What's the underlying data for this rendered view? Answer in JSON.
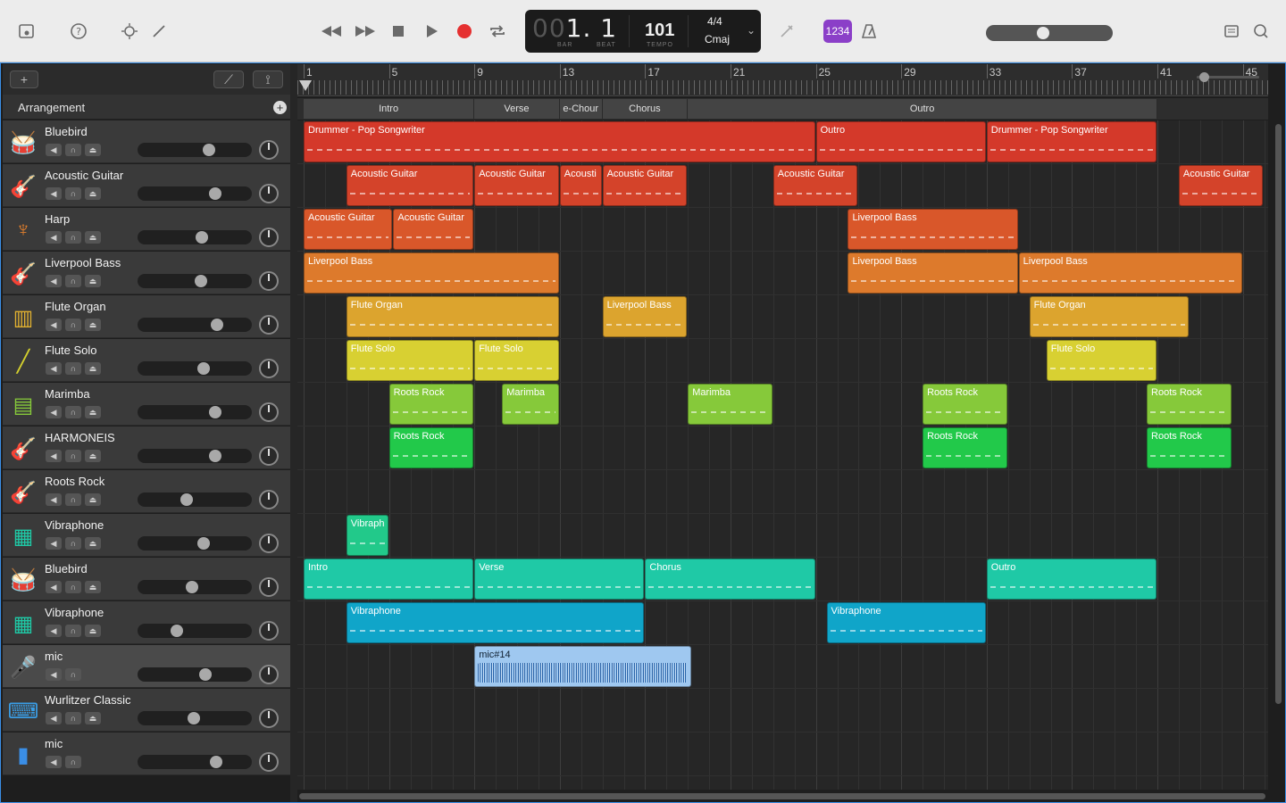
{
  "toolbar": {
    "lcd": {
      "bar_dim": "00",
      "bar": "1",
      "beat": "1",
      "bar_caption": "BAR",
      "beat_caption": "BEAT",
      "tempo": "101",
      "tempo_caption": "TEMPO",
      "signature": "4/4",
      "key": "Cmaj"
    },
    "count_in_label": "1234",
    "master_volume": 0.45,
    "accent_color": "#8b3fc8"
  },
  "sidebar": {
    "add_label": "+",
    "arrangement_label": "Arrangement"
  },
  "ruler": {
    "bars": [
      "1",
      "5",
      "9",
      "13",
      "17",
      "21",
      "25",
      "29",
      "33",
      "37",
      "41",
      "45"
    ]
  },
  "markers": [
    {
      "label": "Intro"
    },
    {
      "label": "Verse"
    },
    {
      "label": "e-Chour"
    },
    {
      "label": "Chorus"
    },
    {
      "label": "Outro"
    }
  ],
  "tracks": [
    {
      "name": "Bluebird",
      "icon": "drum-kit-icon",
      "volume": 0.65
    },
    {
      "name": "Acoustic Guitar",
      "icon": "acoustic-guitar-icon",
      "volume": 0.71
    },
    {
      "name": "Harp",
      "icon": "harp-icon",
      "volume": 0.58
    },
    {
      "name": "Liverpool Bass",
      "icon": "bass-guitar-icon",
      "volume": 0.57
    },
    {
      "name": "Flute Organ",
      "icon": "organ-icon",
      "volume": 0.73
    },
    {
      "name": "Flute Solo",
      "icon": "flute-icon",
      "volume": 0.6
    },
    {
      "name": "Marimba",
      "icon": "marimba-icon",
      "volume": 0.71
    },
    {
      "name": "HARMONEIS",
      "icon": "guitar-icon",
      "volume": 0.71
    },
    {
      "name": "Roots Rock",
      "icon": "guitar-icon",
      "volume": 0.43
    },
    {
      "name": "Vibraphone",
      "icon": "vibraphone-icon",
      "volume": 0.6
    },
    {
      "name": "Bluebird",
      "icon": "drum-kit-icon",
      "volume": 0.48
    },
    {
      "name": "Vibraphone",
      "icon": "vibraphone-icon",
      "volume": 0.33
    },
    {
      "name": "mic",
      "icon": "microphone-icon",
      "volume": 0.62
    },
    {
      "name": "Wurlitzer Classic",
      "icon": "keyboard-icon",
      "volume": 0.5
    },
    {
      "name": "mic",
      "icon": "audio-waveform-icon",
      "volume": 0.72
    }
  ],
  "regions": [
    {
      "track": 0,
      "start": 1,
      "end": 25,
      "label": "Drummer - Pop Songwriter",
      "color": "#d4392a"
    },
    {
      "track": 0,
      "start": 25,
      "end": 33,
      "label": "Outro",
      "color": "#d4392a"
    },
    {
      "track": 0,
      "start": 33,
      "end": 41,
      "label": "Drummer - Pop Songwriter",
      "color": "#d4392a"
    },
    {
      "track": 1,
      "start": 3,
      "end": 9,
      "label": "Acoustic Guitar",
      "color": "#d4432a"
    },
    {
      "track": 1,
      "start": 9,
      "end": 13,
      "label": "Acoustic Guitar",
      "color": "#d4432a"
    },
    {
      "track": 1,
      "start": 13,
      "end": 15,
      "label": "Acousti",
      "color": "#d4432a"
    },
    {
      "track": 1,
      "start": 15,
      "end": 19,
      "label": "Acoustic Guitar",
      "color": "#d4432a"
    },
    {
      "track": 1,
      "start": 23,
      "end": 27,
      "label": "Acoustic Guitar",
      "color": "#d4432a"
    },
    {
      "track": 1,
      "start": 42,
      "end": 46,
      "label": "Acoustic Guitar",
      "color": "#d4432a"
    },
    {
      "track": 2,
      "start": 1,
      "end": 5.2,
      "label": "Acoustic Guitar",
      "color": "#d9572a"
    },
    {
      "track": 2,
      "start": 5.2,
      "end": 9,
      "label": "Acoustic Guitar",
      "color": "#d9572a"
    },
    {
      "track": 2,
      "start": 26.5,
      "end": 34.5,
      "label": "Liverpool Bass",
      "color": "#d9572a"
    },
    {
      "track": 3,
      "start": 1,
      "end": 13,
      "label": "Liverpool Bass",
      "color": "#dd7a2c"
    },
    {
      "track": 3,
      "start": 26.5,
      "end": 34.5,
      "label": "Liverpool Bass",
      "color": "#dd7a2c"
    },
    {
      "track": 3,
      "start": 34.5,
      "end": 45,
      "label": "Liverpool Bass",
      "color": "#dd7a2c"
    },
    {
      "track": 4,
      "start": 3,
      "end": 13,
      "label": "Flute Organ",
      "color": "#dca42e"
    },
    {
      "track": 4,
      "start": 15,
      "end": 19,
      "label": "Liverpool Bass",
      "color": "#dca42e"
    },
    {
      "track": 4,
      "start": 35,
      "end": 42.5,
      "label": "Flute Organ",
      "color": "#dca42e"
    },
    {
      "track": 5,
      "start": 3,
      "end": 9,
      "label": "Flute Solo",
      "color": "#d8d032"
    },
    {
      "track": 5,
      "start": 9,
      "end": 13,
      "label": "Flute Solo",
      "color": "#d8d032"
    },
    {
      "track": 5,
      "start": 35.8,
      "end": 41,
      "label": "Flute Solo",
      "color": "#d8d032"
    },
    {
      "track": 6,
      "start": 5,
      "end": 9,
      "label": "Roots Rock",
      "color": "#86c93a"
    },
    {
      "track": 6,
      "start": 10.3,
      "end": 13,
      "label": "Marimba",
      "color": "#86c93a"
    },
    {
      "track": 6,
      "start": 19,
      "end": 23,
      "label": "Marimba",
      "color": "#86c93a"
    },
    {
      "track": 6,
      "start": 30,
      "end": 34,
      "label": "Roots Rock",
      "color": "#86c93a"
    },
    {
      "track": 6,
      "start": 40.5,
      "end": 44.5,
      "label": "Roots Rock",
      "color": "#86c93a"
    },
    {
      "track": 7,
      "start": 5,
      "end": 9,
      "label": "Roots Rock",
      "color": "#22c94a"
    },
    {
      "track": 7,
      "start": 30,
      "end": 34,
      "label": "Roots Rock",
      "color": "#22c94a"
    },
    {
      "track": 7,
      "start": 40.5,
      "end": 44.5,
      "label": "Roots Rock",
      "color": "#22c94a"
    },
    {
      "track": 9,
      "start": 3,
      "end": 5,
      "label": "Vibraph",
      "color": "#22c98a"
    },
    {
      "track": 10,
      "start": 1,
      "end": 9,
      "label": "Intro",
      "color": "#1fc9a6"
    },
    {
      "track": 10,
      "start": 9,
      "end": 17,
      "label": "Verse",
      "color": "#1fc9a6"
    },
    {
      "track": 10,
      "start": 17,
      "end": 25,
      "label": "Chorus",
      "color": "#1fc9a6"
    },
    {
      "track": 10,
      "start": 33,
      "end": 41,
      "label": "Outro",
      "color": "#1fc9a6"
    },
    {
      "track": 11,
      "start": 3,
      "end": 17,
      "label": "Vibraphone",
      "color": "#10a5c9"
    },
    {
      "track": 11,
      "start": 25.5,
      "end": 33,
      "label": "Vibraphone",
      "color": "#10a5c9"
    },
    {
      "track": 12,
      "start": 9,
      "end": 19.2,
      "label": "mic#14",
      "color": "#9fc8f0",
      "audio": true
    }
  ]
}
